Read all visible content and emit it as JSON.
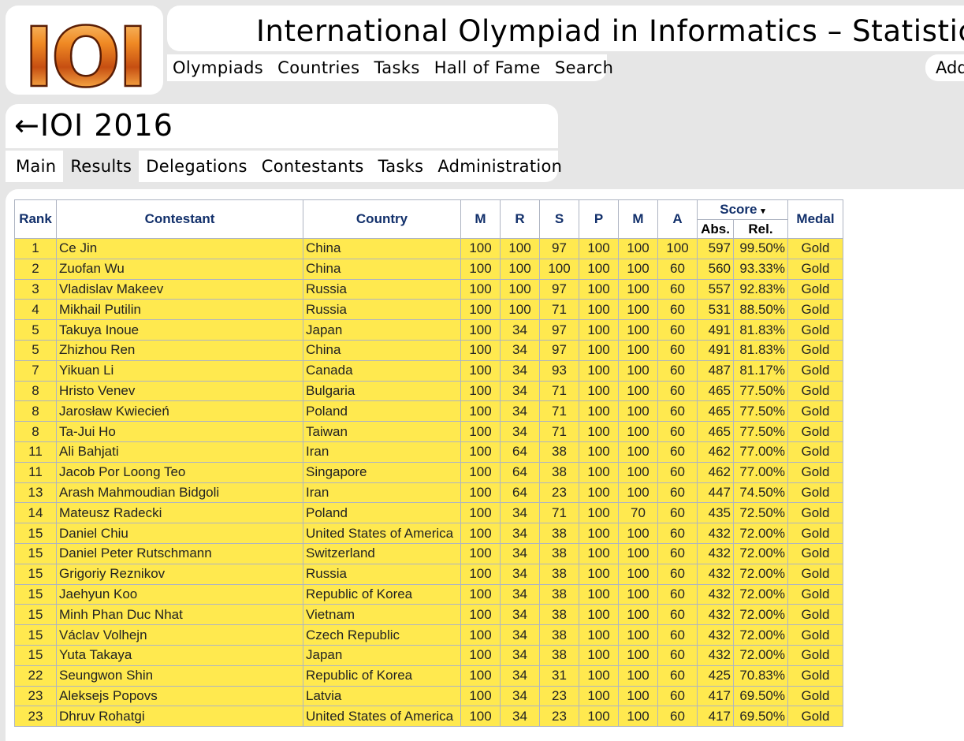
{
  "header": {
    "logo_text": "IOI",
    "site_title": "International Olympiad in Informatics – Statistics",
    "nav": [
      "Olympiads",
      "Countries",
      "Tasks",
      "Hall of Fame",
      "Search"
    ],
    "right_nav_partial": "Add"
  },
  "olympiad": {
    "back_arrow": "←",
    "title": "IOI 2016",
    "tabs": [
      "Main",
      "Results",
      "Delegations",
      "Contestants",
      "Tasks",
      "Administration"
    ],
    "active_tab": "Results"
  },
  "colors": {
    "row_bg": "#ffe94f",
    "header_text": "#12306b",
    "page_bg": "#e6e6e6"
  },
  "table": {
    "headers": {
      "rank": "Rank",
      "contestant": "Contestant",
      "country": "Country",
      "tasks": [
        "M",
        "R",
        "S",
        "P",
        "M",
        "A"
      ],
      "score": "Score",
      "score_sort_icon": "▾",
      "abs": "Abs.",
      "rel": "Rel.",
      "medal": "Medal"
    },
    "rows": [
      {
        "rank": "1",
        "name": "Ce Jin",
        "country": "China",
        "scores": [
          "100",
          "100",
          "97",
          "100",
          "100",
          "100"
        ],
        "abs": "597",
        "rel": "99.50%",
        "medal": "Gold"
      },
      {
        "rank": "2",
        "name": "Zuofan Wu",
        "country": "China",
        "scores": [
          "100",
          "100",
          "100",
          "100",
          "100",
          "60"
        ],
        "abs": "560",
        "rel": "93.33%",
        "medal": "Gold"
      },
      {
        "rank": "3",
        "name": "Vladislav Makeev",
        "country": "Russia",
        "scores": [
          "100",
          "100",
          "97",
          "100",
          "100",
          "60"
        ],
        "abs": "557",
        "rel": "92.83%",
        "medal": "Gold"
      },
      {
        "rank": "4",
        "name": "Mikhail Putilin",
        "country": "Russia",
        "scores": [
          "100",
          "100",
          "71",
          "100",
          "100",
          "60"
        ],
        "abs": "531",
        "rel": "88.50%",
        "medal": "Gold"
      },
      {
        "rank": "5",
        "name": "Takuya Inoue",
        "country": "Japan",
        "scores": [
          "100",
          "34",
          "97",
          "100",
          "100",
          "60"
        ],
        "abs": "491",
        "rel": "81.83%",
        "medal": "Gold"
      },
      {
        "rank": "5",
        "name": "Zhizhou Ren",
        "country": "China",
        "scores": [
          "100",
          "34",
          "97",
          "100",
          "100",
          "60"
        ],
        "abs": "491",
        "rel": "81.83%",
        "medal": "Gold"
      },
      {
        "rank": "7",
        "name": "Yikuan Li",
        "country": "Canada",
        "scores": [
          "100",
          "34",
          "93",
          "100",
          "100",
          "60"
        ],
        "abs": "487",
        "rel": "81.17%",
        "medal": "Gold"
      },
      {
        "rank": "8",
        "name": "Hristo Venev",
        "country": "Bulgaria",
        "scores": [
          "100",
          "34",
          "71",
          "100",
          "100",
          "60"
        ],
        "abs": "465",
        "rel": "77.50%",
        "medal": "Gold"
      },
      {
        "rank": "8",
        "name": "Jarosław Kwiecień",
        "country": "Poland",
        "scores": [
          "100",
          "34",
          "71",
          "100",
          "100",
          "60"
        ],
        "abs": "465",
        "rel": "77.50%",
        "medal": "Gold"
      },
      {
        "rank": "8",
        "name": "Ta-Jui Ho",
        "country": "Taiwan",
        "scores": [
          "100",
          "34",
          "71",
          "100",
          "100",
          "60"
        ],
        "abs": "465",
        "rel": "77.50%",
        "medal": "Gold"
      },
      {
        "rank": "11",
        "name": "Ali Bahjati",
        "country": "Iran",
        "scores": [
          "100",
          "64",
          "38",
          "100",
          "100",
          "60"
        ],
        "abs": "462",
        "rel": "77.00%",
        "medal": "Gold"
      },
      {
        "rank": "11",
        "name": "Jacob Por Loong Teo",
        "country": "Singapore",
        "scores": [
          "100",
          "64",
          "38",
          "100",
          "100",
          "60"
        ],
        "abs": "462",
        "rel": "77.00%",
        "medal": "Gold"
      },
      {
        "rank": "13",
        "name": "Arash Mahmoudian Bidgoli",
        "country": "Iran",
        "scores": [
          "100",
          "64",
          "23",
          "100",
          "100",
          "60"
        ],
        "abs": "447",
        "rel": "74.50%",
        "medal": "Gold"
      },
      {
        "rank": "14",
        "name": "Mateusz Radecki",
        "country": "Poland",
        "scores": [
          "100",
          "34",
          "71",
          "100",
          "70",
          "60"
        ],
        "abs": "435",
        "rel": "72.50%",
        "medal": "Gold"
      },
      {
        "rank": "15",
        "name": "Daniel Chiu",
        "country": "United States of America",
        "scores": [
          "100",
          "34",
          "38",
          "100",
          "100",
          "60"
        ],
        "abs": "432",
        "rel": "72.00%",
        "medal": "Gold"
      },
      {
        "rank": "15",
        "name": "Daniel Peter Rutschmann",
        "country": "Switzerland",
        "scores": [
          "100",
          "34",
          "38",
          "100",
          "100",
          "60"
        ],
        "abs": "432",
        "rel": "72.00%",
        "medal": "Gold"
      },
      {
        "rank": "15",
        "name": "Grigoriy Reznikov",
        "country": "Russia",
        "scores": [
          "100",
          "34",
          "38",
          "100",
          "100",
          "60"
        ],
        "abs": "432",
        "rel": "72.00%",
        "medal": "Gold"
      },
      {
        "rank": "15",
        "name": "Jaehyun Koo",
        "country": "Republic of Korea",
        "scores": [
          "100",
          "34",
          "38",
          "100",
          "100",
          "60"
        ],
        "abs": "432",
        "rel": "72.00%",
        "medal": "Gold"
      },
      {
        "rank": "15",
        "name": "Minh Phan Duc Nhat",
        "country": "Vietnam",
        "scores": [
          "100",
          "34",
          "38",
          "100",
          "100",
          "60"
        ],
        "abs": "432",
        "rel": "72.00%",
        "medal": "Gold"
      },
      {
        "rank": "15",
        "name": "Václav Volhejn",
        "country": "Czech Republic",
        "scores": [
          "100",
          "34",
          "38",
          "100",
          "100",
          "60"
        ],
        "abs": "432",
        "rel": "72.00%",
        "medal": "Gold"
      },
      {
        "rank": "15",
        "name": "Yuta Takaya",
        "country": "Japan",
        "scores": [
          "100",
          "34",
          "38",
          "100",
          "100",
          "60"
        ],
        "abs": "432",
        "rel": "72.00%",
        "medal": "Gold"
      },
      {
        "rank": "22",
        "name": "Seungwon Shin",
        "country": "Republic of Korea",
        "scores": [
          "100",
          "34",
          "31",
          "100",
          "100",
          "60"
        ],
        "abs": "425",
        "rel": "70.83%",
        "medal": "Gold"
      },
      {
        "rank": "23",
        "name": "Aleksejs Popovs",
        "country": "Latvia",
        "scores": [
          "100",
          "34",
          "23",
          "100",
          "100",
          "60"
        ],
        "abs": "417",
        "rel": "69.50%",
        "medal": "Gold"
      },
      {
        "rank": "23",
        "name": "Dhruv Rohatgi",
        "country": "United States of America",
        "scores": [
          "100",
          "34",
          "23",
          "100",
          "100",
          "60"
        ],
        "abs": "417",
        "rel": "69.50%",
        "medal": "Gold"
      }
    ]
  }
}
